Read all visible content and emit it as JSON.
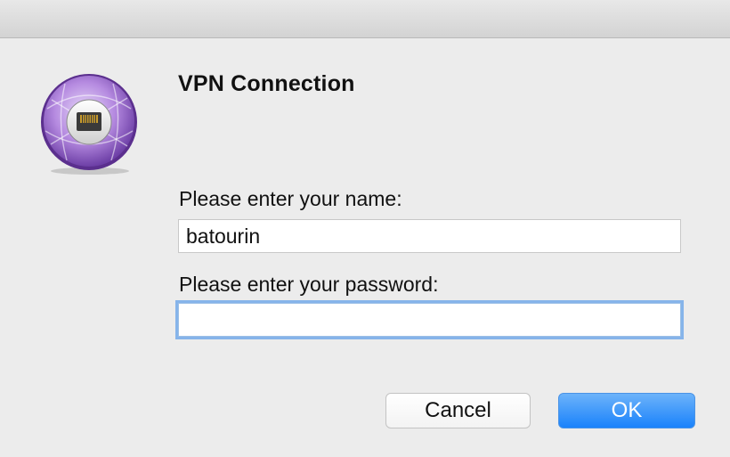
{
  "dialog": {
    "title": "VPN Connection",
    "icon": "vpn-network-icon"
  },
  "form": {
    "name_label": "Please enter your name:",
    "name_value": "batourin",
    "password_label": "Please enter your password:",
    "password_value": ""
  },
  "buttons": {
    "cancel_label": "Cancel",
    "ok_label": "OK"
  },
  "colors": {
    "accent": "#1a82fb",
    "icon_purple": "#9b6fd1",
    "background": "#ececec"
  }
}
